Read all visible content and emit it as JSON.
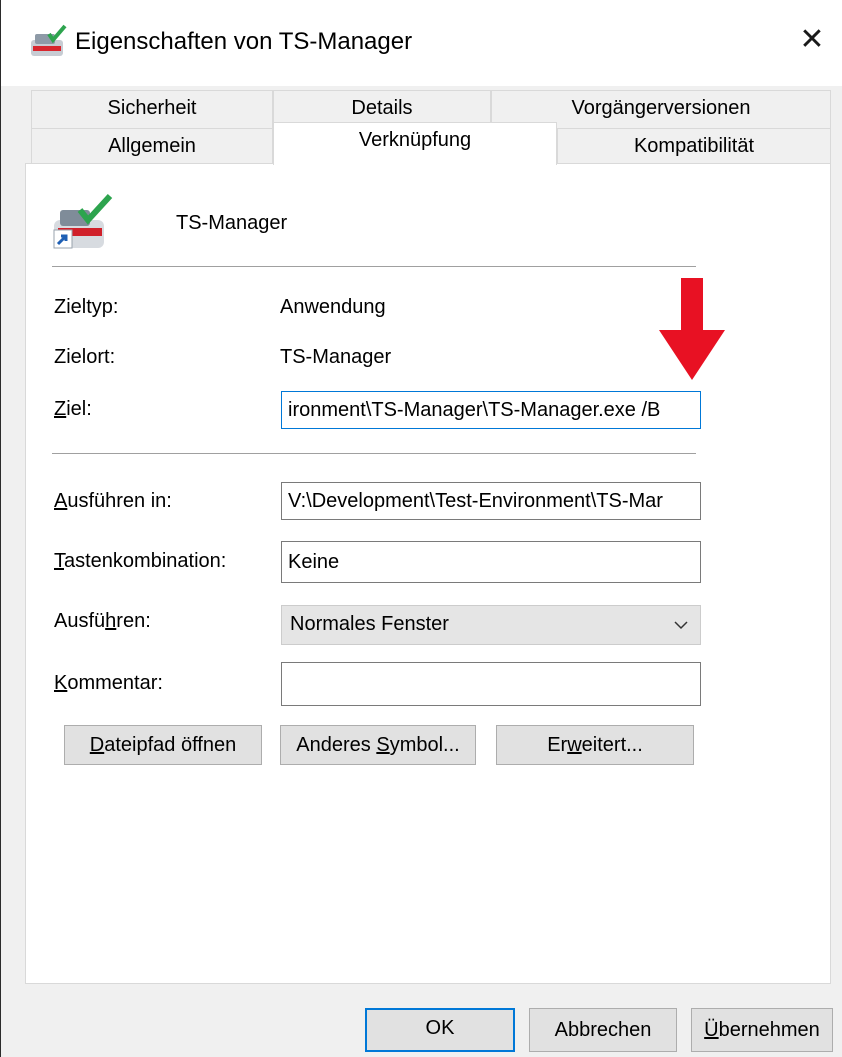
{
  "window": {
    "title": "Eigenschaften von TS-Manager",
    "close_glyph": "✕"
  },
  "tabs": {
    "row1": [
      {
        "label": "Sicherheit"
      },
      {
        "label": "Details"
      },
      {
        "label": "Vorgängerversionen"
      }
    ],
    "row2": [
      {
        "label": "Allgemein"
      },
      {
        "label": "Verknüpfung",
        "active": true
      },
      {
        "label": "Kompatibilität"
      }
    ]
  },
  "shortcut": {
    "app_name": "TS-Manager",
    "icon": "ts-manager-shortcut-icon",
    "zieltyp_label": "Zieltyp:",
    "zieltyp_value": "Anwendung",
    "zielort_label": "Zielort:",
    "zielort_value": "TS-Manager",
    "ziel_label_u": "Z",
    "ziel_label_rest": "iel:",
    "ziel_value": "ironment\\TS-Manager\\TS-Manager.exe /B",
    "ausfuehren_in_label_u": "A",
    "ausfuehren_in_label_rest": "usführen in:",
    "ausfuehren_in_value": "V:\\Development\\Test-Environment\\TS-Mar",
    "taste_label_u": "T",
    "taste_label_rest": "astenkombination:",
    "taste_value": "Keine",
    "run_label_pre": "Ausfü",
    "run_label_u": "h",
    "run_label_post": "ren:",
    "run_value": "Normales Fenster",
    "kommentar_label_u": "K",
    "kommentar_label_rest": "ommentar:",
    "kommentar_value": ""
  },
  "buttons": {
    "dateipfad_u": "D",
    "dateipfad_rest": "ateipfad öffnen",
    "symbol_pre": "Anderes ",
    "symbol_u": "S",
    "symbol_post": "ymbol...",
    "erweitert_pre": "Er",
    "erweitert_u": "w",
    "erweitert_post": "eitert...",
    "ok": "OK",
    "abbrechen": "Abbrechen",
    "uebernehmen_u": "Ü",
    "uebernehmen_rest": "bernehmen"
  },
  "annotation": {
    "arrow_color": "#e81123",
    "focus_color": "#0078d7"
  }
}
